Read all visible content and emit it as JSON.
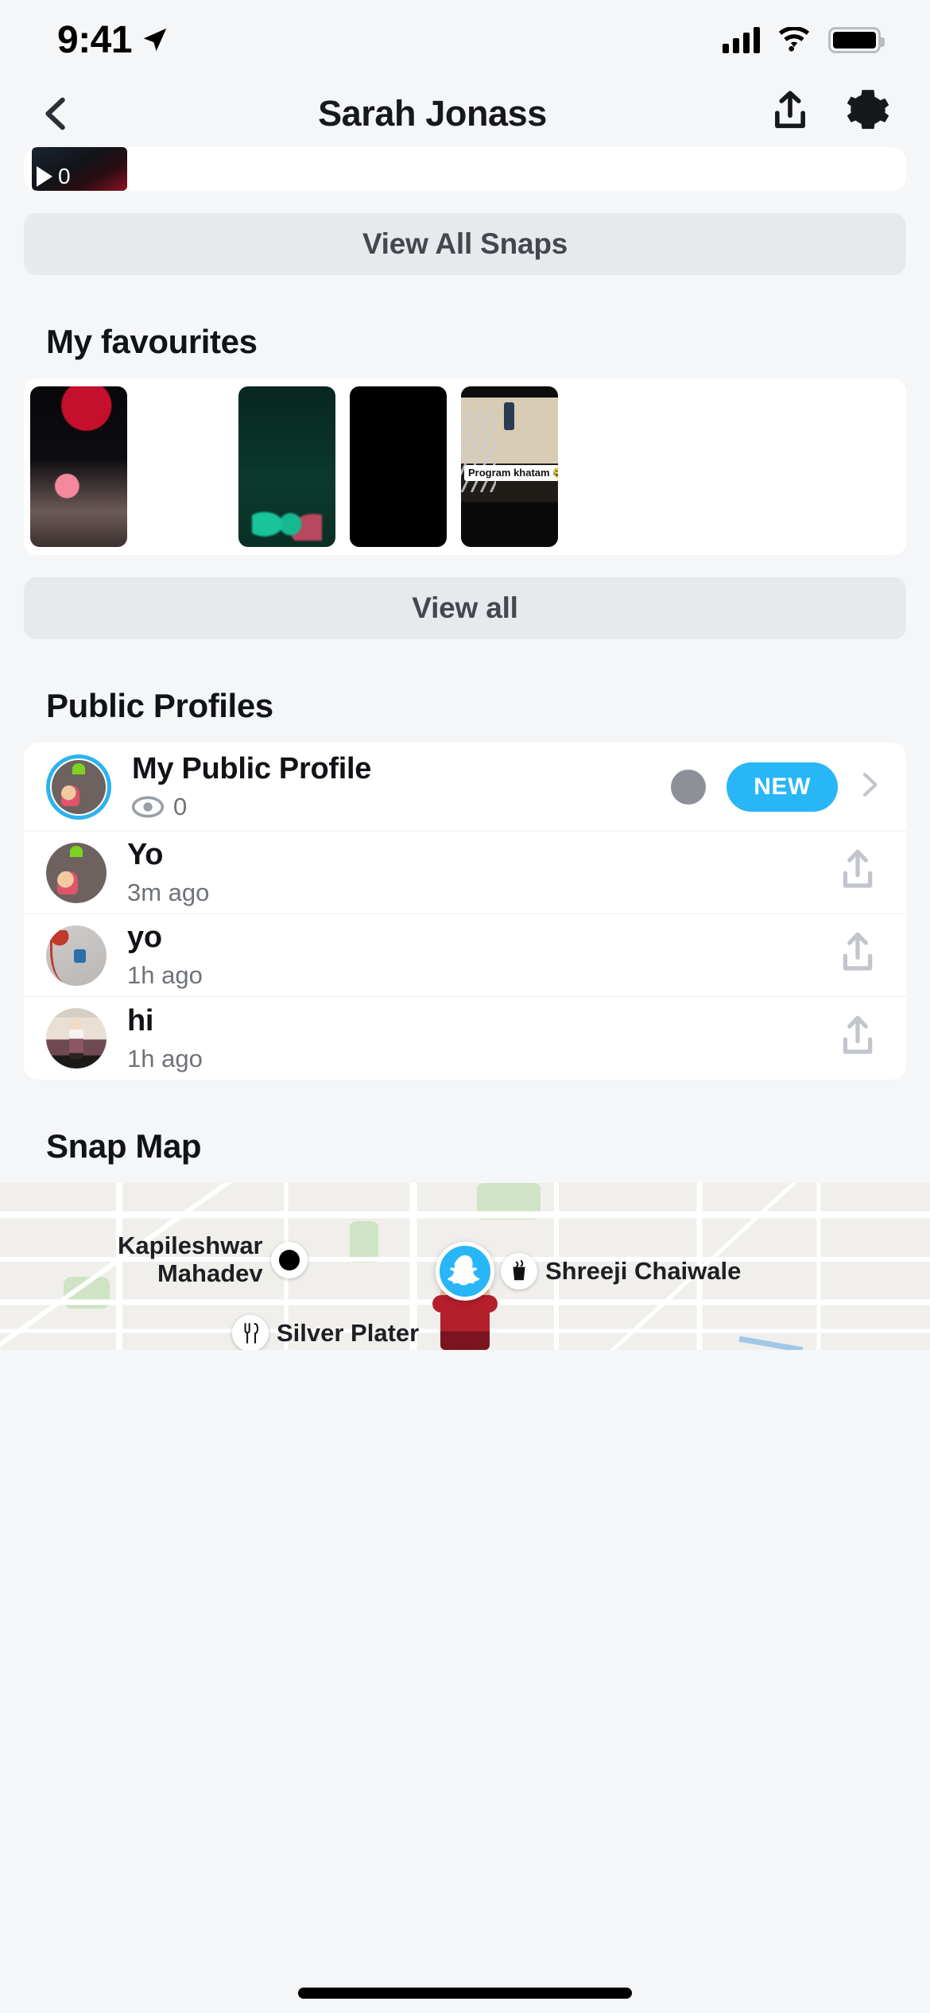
{
  "status_bar": {
    "time": "9:41",
    "location_icon": "location-arrow-icon",
    "cellular_icon": "cellular-bars-icon",
    "wifi_icon": "wifi-icon",
    "battery_icon": "battery-full-icon"
  },
  "nav": {
    "back_icon": "chevron-left-icon",
    "title": "Sarah Jonass",
    "share_icon": "share-upload-icon",
    "settings_icon": "gear-icon"
  },
  "snaps": {
    "thumb_play_icon": "play-icon",
    "thumb_count": "0",
    "view_all_label": "View All Snaps"
  },
  "favourites": {
    "title": "My favourites",
    "items": [
      {
        "name": "favourite-thumb-car",
        "caption": ""
      },
      {
        "name": "favourite-thumb-blank",
        "caption": ""
      },
      {
        "name": "favourite-thumb-green-lights",
        "caption": ""
      },
      {
        "name": "favourite-thumb-black",
        "caption": ""
      },
      {
        "name": "favourite-thumb-stairs",
        "caption": "Program khatam 😂😂"
      }
    ],
    "view_all_label": "View all"
  },
  "public_profiles": {
    "title": "Public Profiles",
    "my_profile": {
      "name": "My Public Profile",
      "views_icon": "eye-icon",
      "views_count": "0",
      "badge": "NEW",
      "badge_color": "#29b6f6",
      "chevron_icon": "chevron-right-icon",
      "avatar": "bitmoji-avatar"
    },
    "rows": [
      {
        "name": "Yo",
        "time": "3m ago",
        "avatar": "bitmoji-avatar",
        "action_icon": "share-upload-icon"
      },
      {
        "name": "yo",
        "time": "1h ago",
        "avatar": "photo-avatar",
        "action_icon": "share-upload-icon"
      },
      {
        "name": "hi",
        "time": "1h ago",
        "avatar": "person-avatar",
        "action_icon": "share-upload-icon"
      }
    ]
  },
  "snap_map": {
    "title": "Snap Map",
    "places": [
      {
        "label": "Kapileshwar\nMahadev",
        "icon": "map-dot-icon"
      },
      {
        "label": "Shreeji Chaiwale",
        "icon": "cup-icon"
      },
      {
        "label": "Silver Plater",
        "icon": "cutlery-icon"
      }
    ],
    "my_pin_icon": "snapchat-ghost-icon",
    "my_pin_color": "#29b6f6"
  }
}
